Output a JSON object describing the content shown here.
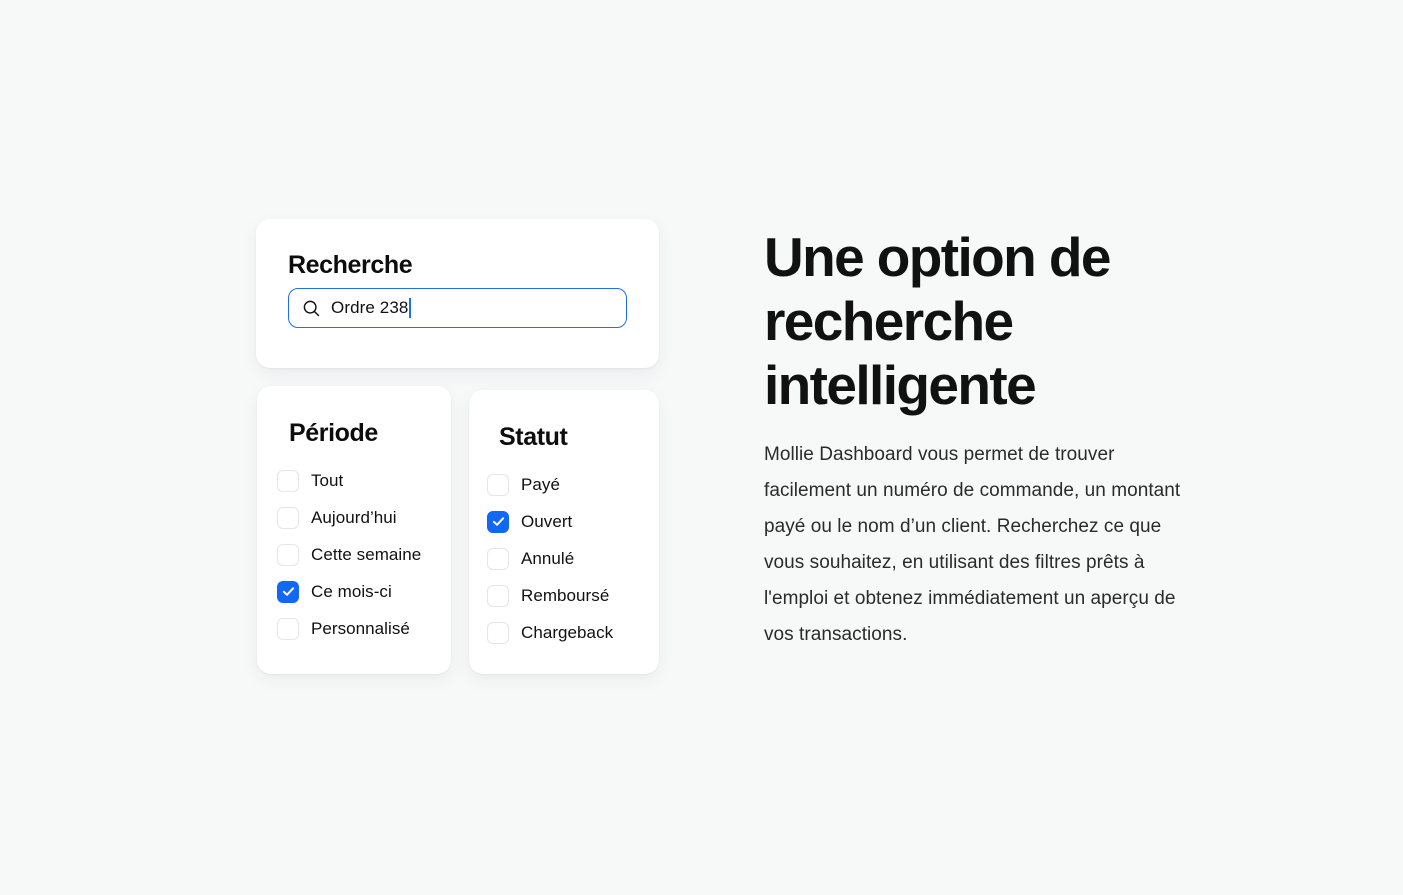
{
  "theme": {
    "page_background": "#f7f8f8",
    "card_background": "#ffffff",
    "accent_blue": "#1068f5",
    "focus_border": "#1f6feb",
    "text_primary": "#111111",
    "checkbox_border": "#e3e5e8"
  },
  "search_card": {
    "title": "Recherche",
    "input": {
      "icon": "search-icon",
      "value": "Ordre 238",
      "placeholder": "Rechercher",
      "focused": true
    }
  },
  "period_card": {
    "title": "Période",
    "options": [
      {
        "label": "Tout",
        "checked": false
      },
      {
        "label": "Aujourd’hui",
        "checked": false
      },
      {
        "label": "Cette semaine",
        "checked": false
      },
      {
        "label": "Ce mois-ci",
        "checked": true
      },
      {
        "label": "Personnalisé",
        "checked": false
      }
    ]
  },
  "status_card": {
    "title": "Statut",
    "options": [
      {
        "label": "Payé",
        "checked": false
      },
      {
        "label": "Ouvert",
        "checked": true
      },
      {
        "label": "Annulé",
        "checked": false
      },
      {
        "label": "Remboursé",
        "checked": false
      },
      {
        "label": "Chargeback",
        "checked": false
      }
    ]
  },
  "copy": {
    "headline": "Une option de recherche intelligente",
    "body": "Mollie Dashboard vous permet de trouver facilement un numéro de commande, un montant payé ou le nom d’un client. Recherchez ce que vous souhaitez, en utilisant des filtres prêts à l'emploi et obtenez immédiatement un aperçu de vos transactions."
  }
}
